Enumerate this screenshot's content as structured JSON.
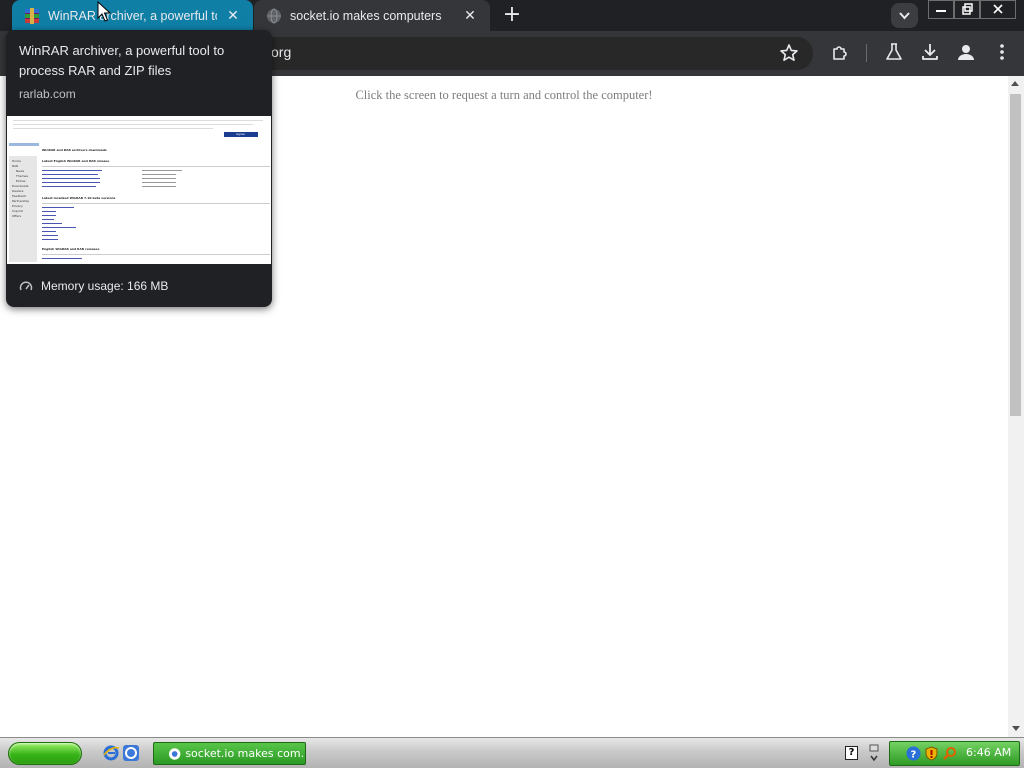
{
  "browser": {
    "tabs": [
      {
        "title": "WinRAR archiver, a powerful tool to process RAR and ZIP files",
        "active": true,
        "icon": "winrar-icon"
      },
      {
        "title": "socket.io makes computers",
        "active": false,
        "icon": "globe-icon"
      }
    ],
    "address_fragment": "org",
    "colors": {
      "active_tab": "#0f7fa6",
      "frame": "#202124",
      "toolbar": "#353639"
    }
  },
  "hover_card": {
    "title": "WinRAR archiver, a powerful tool to process RAR and ZIP files",
    "domain": "rarlab.com",
    "memory": "Memory usage: 166 MB",
    "preview": {
      "cookie_button": "Agree",
      "heading": "WinRAR and RAR archivers downloads",
      "nav": [
        "Home",
        "RAR",
        "News",
        "Themes",
        "Extras",
        "Downloads",
        "Dealers",
        "Feedback",
        "Partnership",
        "Privacy",
        "Imprint",
        "Offers"
      ],
      "section1": "Latest English WinRAR and RAR release",
      "section2": "Latest localized WinRAR 7.10 beta versions",
      "section3": "English WinRAR and RAR releases"
    }
  },
  "page": {
    "hint": "Click the screen to request a turn and control the computer!"
  },
  "taskbar": {
    "task_label": "socket.io makes com...",
    "clock": "6:46 AM",
    "colors": {
      "start": "#37b418",
      "task": "#2b9a25"
    }
  }
}
